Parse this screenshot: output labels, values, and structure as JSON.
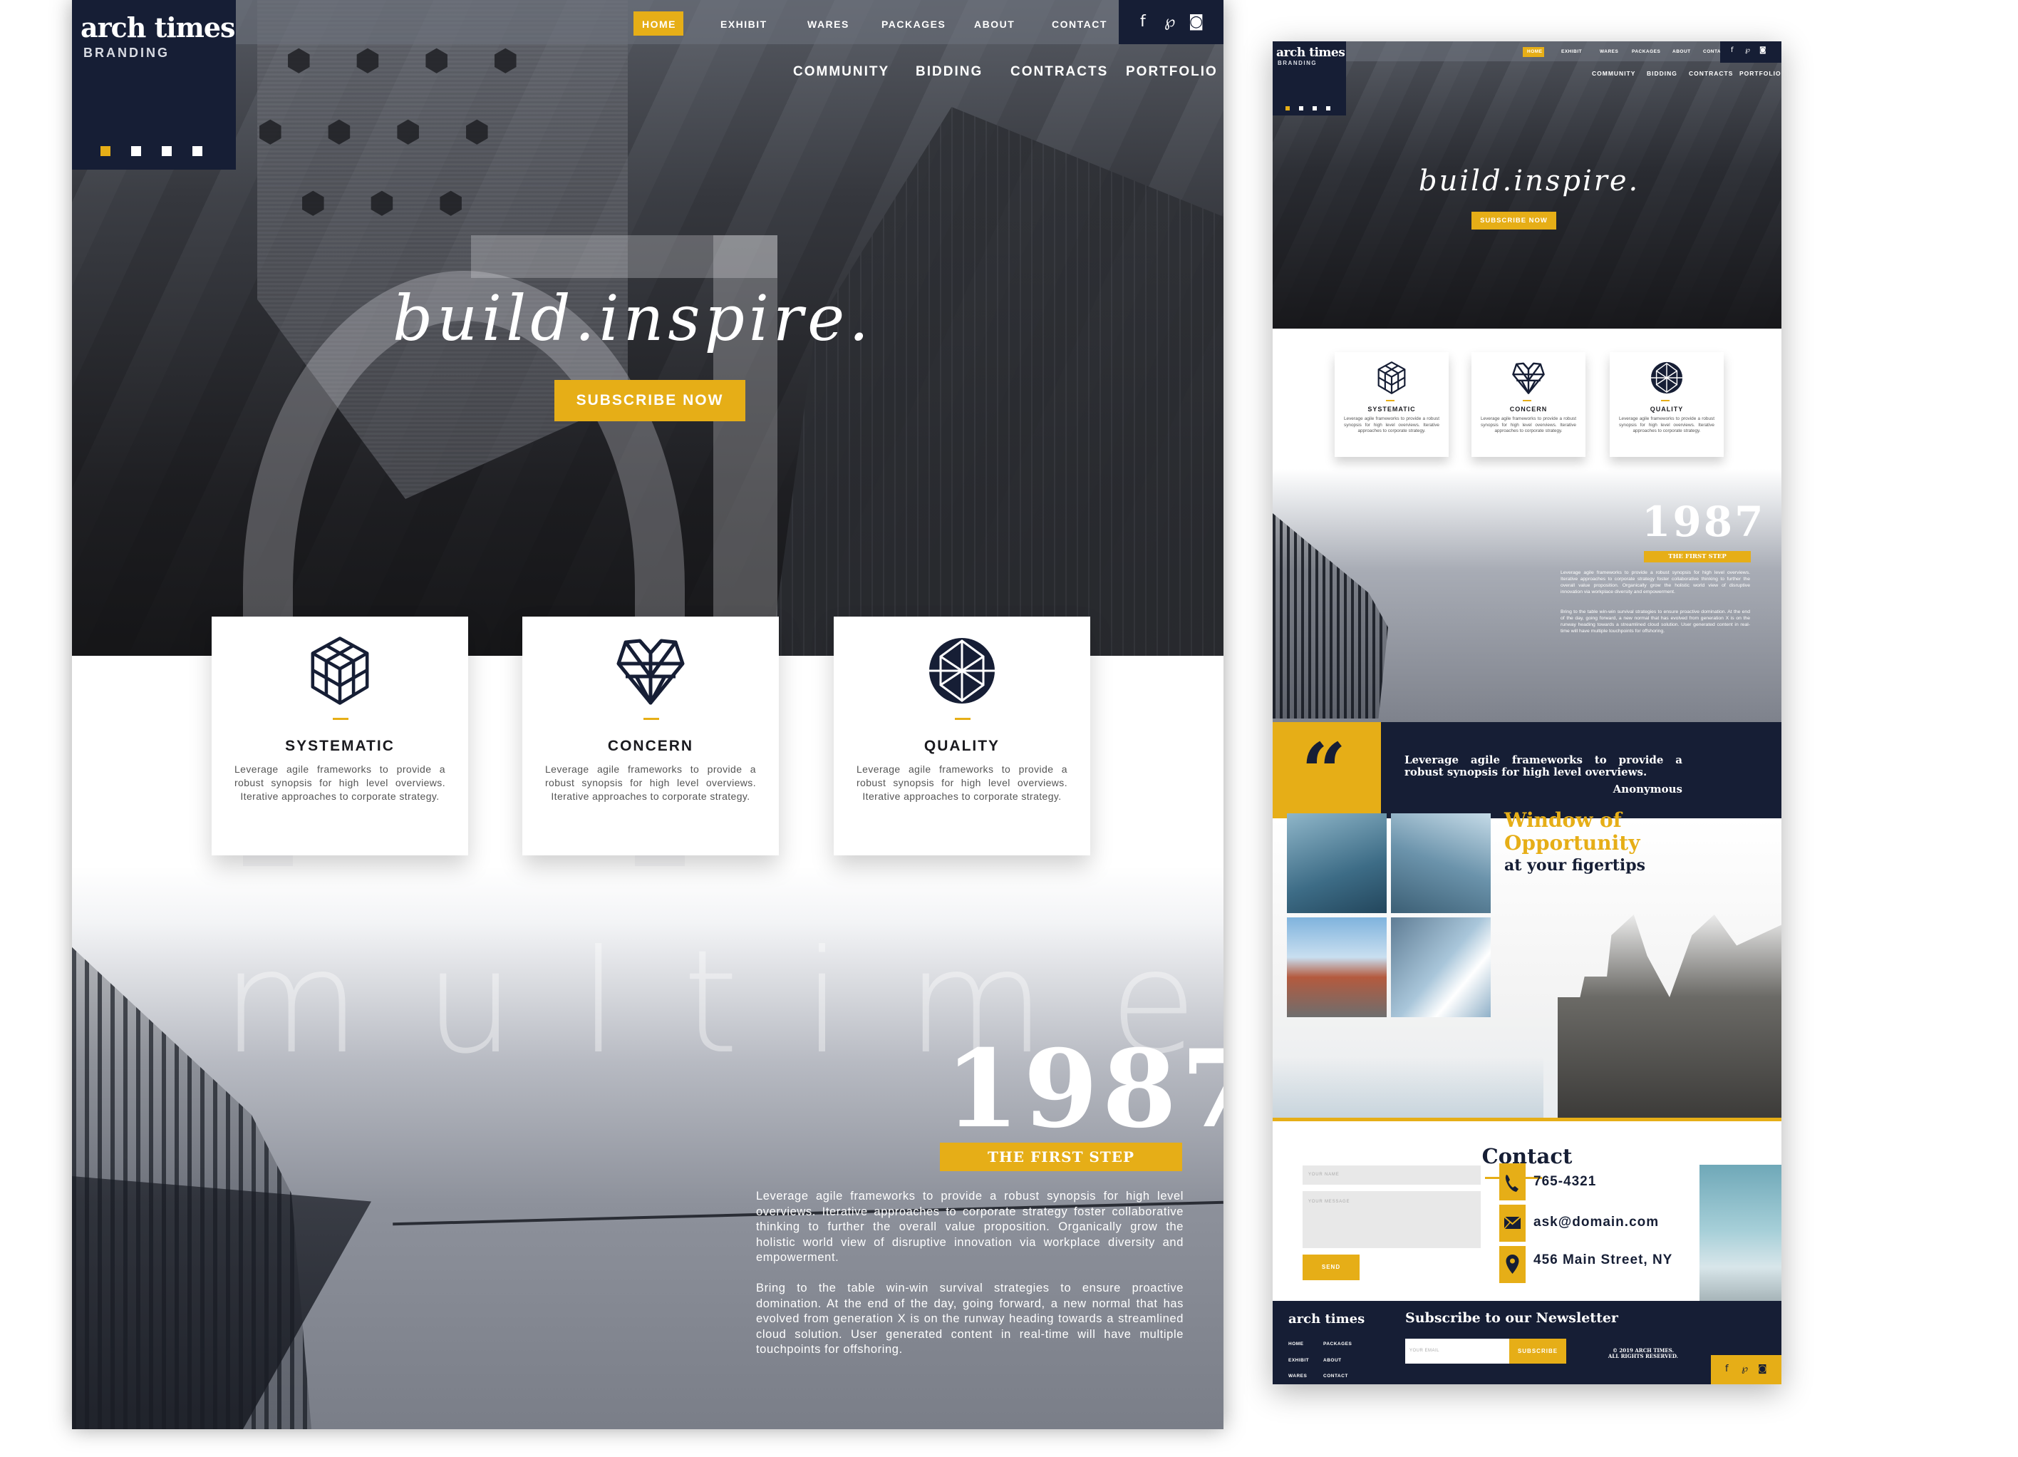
{
  "brand": {
    "name": "arch times",
    "subtitle": "BRANDING",
    "colors": {
      "navy": "#161e35",
      "gold": "#e6ae17",
      "white": "#ffffff"
    }
  },
  "nav": {
    "primary": [
      "HOME",
      "EXHIBIT",
      "WARES",
      "PACKAGES",
      "ABOUT",
      "CONTACT"
    ],
    "active": "HOME",
    "secondary": [
      "COMMUNITY",
      "BIDDING",
      "CONTRACTS",
      "PORTFOLIO"
    ],
    "social": [
      {
        "name": "facebook-icon",
        "glyph": "f"
      },
      {
        "name": "pinterest-icon",
        "glyph": "℘"
      },
      {
        "name": "instagram-icon",
        "glyph": "◙"
      }
    ],
    "slider_dots": 4,
    "slider_active_index": 0
  },
  "hero": {
    "tagline": "build.inspire.",
    "cta": "SUBSCRIBE NOW"
  },
  "features": [
    {
      "icon": "cube-icon",
      "title": "SYSTEMATIC",
      "text": "Leverage agile frameworks to provide a robust synopsis for high level overviews. Iterative approaches to corporate strategy."
    },
    {
      "icon": "geometric-heart-icon",
      "title": "CONCERN",
      "text": "Leverage agile frameworks to provide a robust synopsis for high level overviews. Iterative approaches to corporate strategy."
    },
    {
      "icon": "gem-sphere-icon",
      "title": "QUALITY",
      "text": "Leverage agile frameworks to provide a robust synopsis for high level overviews. Iterative approaches to corporate strategy."
    }
  ],
  "history": {
    "watermark": "multime",
    "year": "1987",
    "label": "THE FIRST STEP",
    "paragraphs": [
      "Leverage agile frameworks to provide a robust synopsis for high level overviews. Iterative approaches to corporate strategy foster collaborative thinking to further the overall value proposition. Organically grow the holistic world view of disruptive innovation via workplace diversity and empowerment.",
      "Bring to the table win-win survival strategies to ensure proactive domination. At the end of the day, going forward, a new normal that has evolved from generation X is on the runway heading towards a streamlined cloud solution. User generated content in real-time will have multiple touchpoints for offshoring."
    ]
  },
  "quote": {
    "mark": "“",
    "text": "Leverage agile frameworks to provide a robust synopsis for high level overviews.",
    "author": "Anonymous"
  },
  "opportunity": {
    "line1": "Window of",
    "line2": "Opportunity",
    "line3": "at your figertips"
  },
  "contact": {
    "heading": "Contact",
    "name_placeholder": "YOUR NAME",
    "message_placeholder": "YOUR MESSAGE",
    "send": "SEND",
    "phone": "765-4321",
    "email": "ask@domain.com",
    "address": "456 Main Street, NY"
  },
  "footer": {
    "brand": "arch times",
    "links": [
      "HOME",
      "PACKAGES",
      "EXHIBIT",
      "ABOUT",
      "WARES",
      "CONTACT"
    ],
    "newsletter_title": "Subscribe to our Newsletter",
    "email_placeholder": "YOUR EMAIL",
    "subscribe": "SUBSCRIBE",
    "copyright_line1": "© 2019 ARCH TIMES.",
    "copyright_line2": "ALL RIGHTS RESERVED."
  }
}
